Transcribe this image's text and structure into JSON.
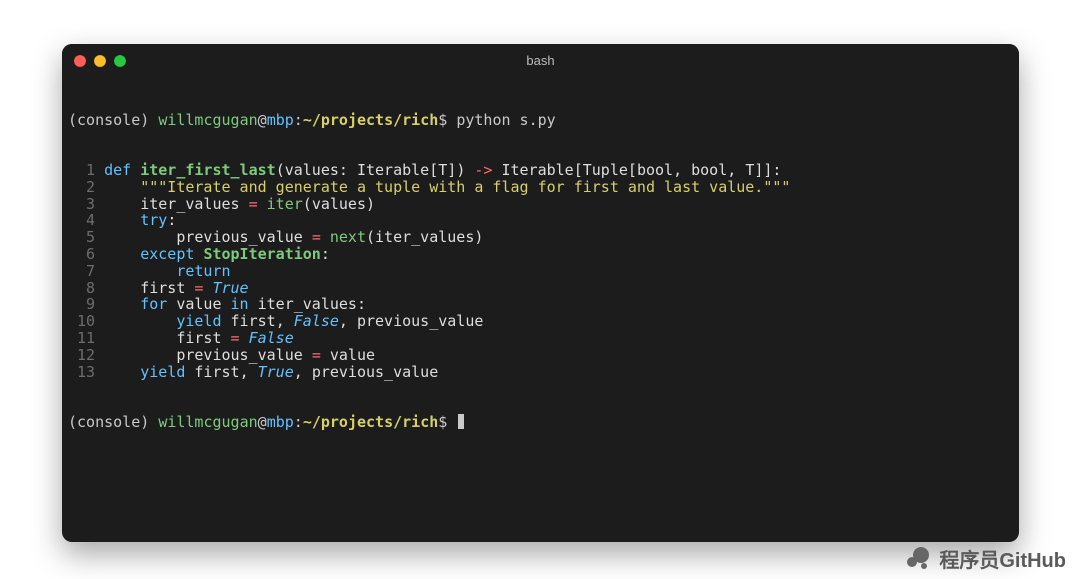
{
  "window": {
    "title": "bash"
  },
  "prompt": {
    "env": "(console)",
    "user": "willmcgugan",
    "at": "@",
    "host": "mbp",
    "colon": ":",
    "path": "~/projects/rich",
    "dollar": "$",
    "command": "python s.py"
  },
  "code": [
    {
      "n": "1",
      "tokens": [
        [
          "kw",
          "def "
        ],
        [
          "fn",
          "iter_first_last"
        ],
        [
          "pn",
          "("
        ],
        [
          "name",
          "values"
        ],
        [
          "pn",
          ": "
        ],
        [
          "tp",
          "Iterable"
        ],
        [
          "pn",
          "["
        ],
        [
          "tp",
          "T"
        ],
        [
          "pn",
          "]"
        ],
        [
          "pn",
          ") "
        ],
        [
          "op",
          "->"
        ],
        [
          "pn",
          " "
        ],
        [
          "tp",
          "Iterable"
        ],
        [
          "pn",
          "["
        ],
        [
          "tp",
          "Tuple"
        ],
        [
          "pn",
          "["
        ],
        [
          "tp",
          "bool"
        ],
        [
          "pn",
          ", "
        ],
        [
          "tp",
          "bool"
        ],
        [
          "pn",
          ", "
        ],
        [
          "tp",
          "T"
        ],
        [
          "pn",
          "]]"
        ],
        [
          "pn",
          ":"
        ]
      ]
    },
    {
      "n": "2",
      "tokens": [
        [
          "pn",
          "    "
        ],
        [
          "str",
          "\"\"\"Iterate and generate a tuple with a flag for first and last value.\"\"\""
        ]
      ]
    },
    {
      "n": "3",
      "tokens": [
        [
          "pn",
          "    "
        ],
        [
          "name",
          "iter_values "
        ],
        [
          "op",
          "="
        ],
        [
          "pn",
          " "
        ],
        [
          "bi",
          "iter"
        ],
        [
          "pn",
          "("
        ],
        [
          "name",
          "values"
        ],
        [
          "pn",
          ")"
        ]
      ]
    },
    {
      "n": "4",
      "tokens": [
        [
          "pn",
          "    "
        ],
        [
          "kw",
          "try"
        ],
        [
          "pn",
          ":"
        ]
      ]
    },
    {
      "n": "5",
      "tokens": [
        [
          "pn",
          "        "
        ],
        [
          "name",
          "previous_value "
        ],
        [
          "op",
          "="
        ],
        [
          "pn",
          " "
        ],
        [
          "bi",
          "next"
        ],
        [
          "pn",
          "("
        ],
        [
          "name",
          "iter_values"
        ],
        [
          "pn",
          ")"
        ]
      ]
    },
    {
      "n": "6",
      "tokens": [
        [
          "pn",
          "    "
        ],
        [
          "kw",
          "except"
        ],
        [
          "pn",
          " "
        ],
        [
          "exc",
          "StopIteration"
        ],
        [
          "pn",
          ":"
        ]
      ]
    },
    {
      "n": "7",
      "tokens": [
        [
          "pn",
          "        "
        ],
        [
          "kw",
          "return"
        ]
      ]
    },
    {
      "n": "8",
      "tokens": [
        [
          "pn",
          "    "
        ],
        [
          "name",
          "first "
        ],
        [
          "op",
          "="
        ],
        [
          "pn",
          " "
        ],
        [
          "bool",
          "True"
        ]
      ]
    },
    {
      "n": "9",
      "tokens": [
        [
          "pn",
          "    "
        ],
        [
          "kw",
          "for"
        ],
        [
          "pn",
          " "
        ],
        [
          "name",
          "value"
        ],
        [
          "pn",
          " "
        ],
        [
          "kw",
          "in"
        ],
        [
          "pn",
          " "
        ],
        [
          "name",
          "iter_values"
        ],
        [
          "pn",
          ":"
        ]
      ]
    },
    {
      "n": "10",
      "tokens": [
        [
          "pn",
          "        "
        ],
        [
          "kw",
          "yield"
        ],
        [
          "pn",
          " "
        ],
        [
          "name",
          "first"
        ],
        [
          "pn",
          ", "
        ],
        [
          "bool",
          "False"
        ],
        [
          "pn",
          ", "
        ],
        [
          "name",
          "previous_value"
        ]
      ]
    },
    {
      "n": "11",
      "tokens": [
        [
          "pn",
          "        "
        ],
        [
          "name",
          "first "
        ],
        [
          "op",
          "="
        ],
        [
          "pn",
          " "
        ],
        [
          "bool",
          "False"
        ]
      ]
    },
    {
      "n": "12",
      "tokens": [
        [
          "pn",
          "        "
        ],
        [
          "name",
          "previous_value "
        ],
        [
          "op",
          "="
        ],
        [
          "pn",
          " "
        ],
        [
          "name",
          "value"
        ]
      ]
    },
    {
      "n": "13",
      "tokens": [
        [
          "pn",
          "    "
        ],
        [
          "kw",
          "yield"
        ],
        [
          "pn",
          " "
        ],
        [
          "name",
          "first"
        ],
        [
          "pn",
          ", "
        ],
        [
          "bool",
          "True"
        ],
        [
          "pn",
          ", "
        ],
        [
          "name",
          "previous_value"
        ]
      ]
    }
  ],
  "watermark": {
    "text": "程序员GitHub"
  }
}
